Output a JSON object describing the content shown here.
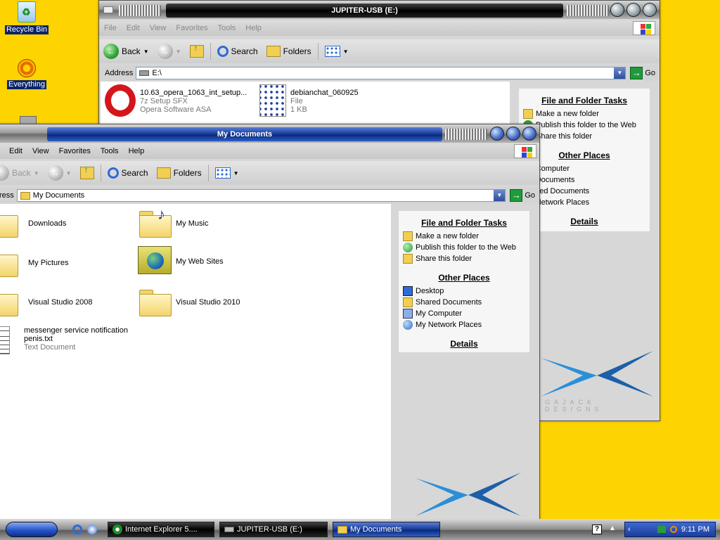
{
  "desktop": {
    "icons": [
      {
        "label": "Recycle Bin",
        "icon": "recycle-bin-icon"
      },
      {
        "label": "Everything",
        "icon": "everything-icon"
      }
    ]
  },
  "back_window": {
    "title": "JUPITER-USB (E:)",
    "menu": [
      "File",
      "Edit",
      "View",
      "Favorites",
      "Tools",
      "Help"
    ],
    "toolbar": {
      "back": "Back",
      "search": "Search",
      "folders": "Folders"
    },
    "address_label": "Address",
    "address_value": "E:\\",
    "go_label": "Go",
    "files": [
      {
        "name": "10.63_opera_1063_int_setup...",
        "line2": "7z Setup SFX",
        "line3": "Opera Software ASA",
        "icon": "opera-icon"
      },
      {
        "name": "debianchat_060925",
        "line2": "File",
        "line3": "1 KB",
        "icon": "file-icon"
      }
    ],
    "tasks_heading": "File and Folder Tasks",
    "tasks": [
      "Make a new folder",
      "Publish this folder to the Web",
      "Share this folder"
    ],
    "places_heading": "Other Places",
    "places": [
      "My Computer",
      "My Documents",
      "Shared Documents",
      "My Network Places"
    ],
    "details_heading": "Details",
    "brand_text": "GAJACK DESIGNS"
  },
  "front_window": {
    "title": "My Documents",
    "menu": [
      "Edit",
      "View",
      "Favorites",
      "Tools",
      "Help"
    ],
    "toolbar": {
      "back": "Back",
      "search": "Search",
      "folders": "Folders"
    },
    "address_label": "ress",
    "address_value": "My Documents",
    "go_label": "Go",
    "items": [
      {
        "name": "Downloads",
        "icon": "downloads-folder-icon"
      },
      {
        "name": "My Music",
        "icon": "music-folder-icon"
      },
      {
        "name": "My Pictures",
        "icon": "pictures-folder-icon"
      },
      {
        "name": "My Web Sites",
        "icon": "web-sites-folder-icon"
      },
      {
        "name": "Visual Studio 2008",
        "icon": "folder-icon"
      },
      {
        "name": "Visual Studio 2010",
        "icon": "folder-icon"
      },
      {
        "name": "messenger service notification",
        "name2": "penis.txt",
        "type": "Text Document",
        "icon": "text-document-icon"
      }
    ],
    "tasks_heading": "File and Folder Tasks",
    "tasks": [
      "Make a new folder",
      "Publish this folder to the Web",
      "Share this folder"
    ],
    "places_heading": "Other Places",
    "places": [
      "Desktop",
      "Shared Documents",
      "My Computer",
      "My Network Places"
    ],
    "details_heading": "Details"
  },
  "taskbar": {
    "buttons": [
      "Internet Explorer 5....",
      "JUPITER-USB (E:)",
      "My Documents"
    ],
    "clock": "9:11 PM"
  },
  "colors": {
    "desktop": "#fdd300",
    "accent": "#1b3f9c",
    "panel": "#d7d7d7"
  }
}
